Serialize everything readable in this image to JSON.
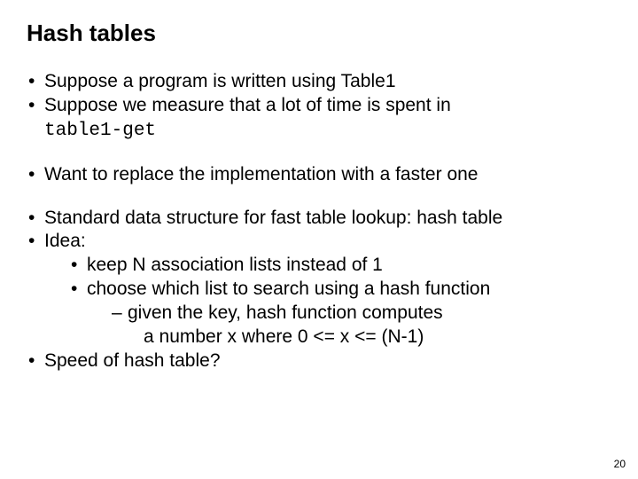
{
  "title": "Hash tables",
  "bullets": {
    "b1": "Suppose a program is written using Table1",
    "b2": "Suppose we measure that a lot of time is spent in ",
    "b2_code": "table1-get",
    "b3": "Want to replace the implementation with a faster one",
    "b4_pre": "Standard data structure for fast table lookup: ",
    "b4_em": "hash table",
    "b5": "Idea:",
    "b5a": "keep N association lists instead of 1",
    "b5b_pre": "choose which list to search using a ",
    "b5b_em": "hash function",
    "b5b_d1": "given the key, hash function computes",
    "b5b_d2": "a number x  where 0 <= x <= (N-1)",
    "b6": "Speed of hash table?"
  },
  "page_number": "20"
}
